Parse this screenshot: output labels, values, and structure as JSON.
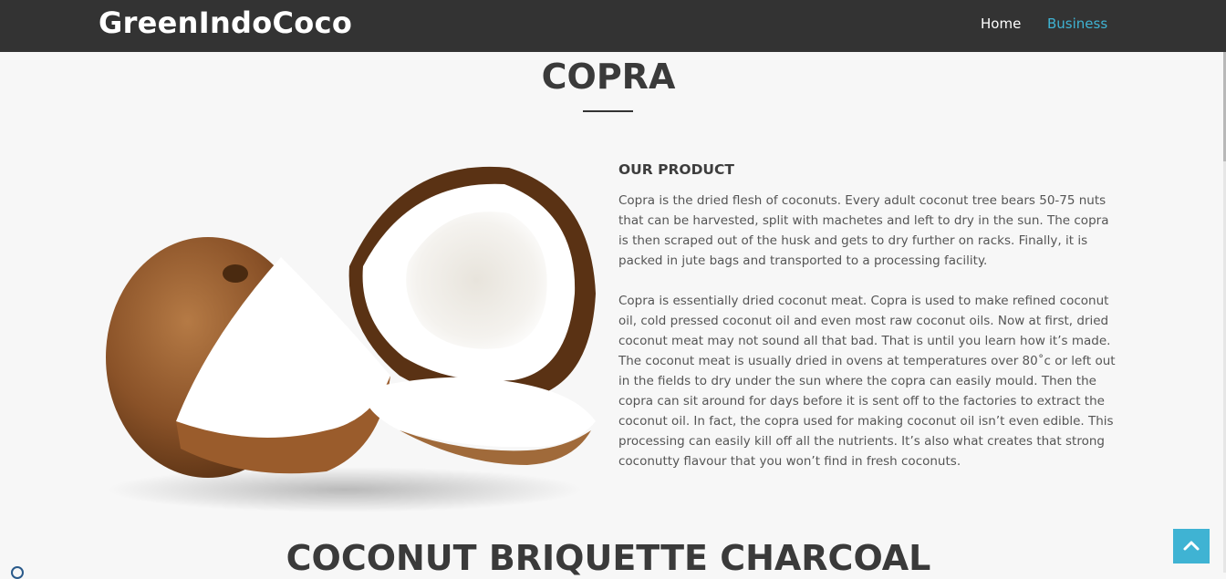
{
  "navbar": {
    "brand": "GreenIndoCoco",
    "links": [
      {
        "label": "Home"
      },
      {
        "label": "Business",
        "active": true
      }
    ],
    "active_color": "#3fb3d3"
  },
  "copra_section": {
    "title": "COPRA",
    "image": {
      "icon": "coconut-halves-photo"
    },
    "product_heading": "OUR PRODUCT",
    "paragraphs": [
      "Copra is the dried flesh of coconuts. Every adult coconut tree bears 50-75 nuts that can be harvested, split with machetes and left to dry in the sun. The copra is then scraped out of the husk and gets to dry further on racks. Finally, it is packed in jute bags and transported to a processing facility.",
      "Copra is essentially dried coconut meat. Copra is used to make refined coconut oil, cold pressed coconut oil and even most raw coconut oils. Now at first, dried coconut meat may not sound all that bad. That is until you learn how it’s made. The coconut meat is usually dried in ovens at temperatures over 80˚c or left out in the fields to dry under the sun where the copra can easily mould. Then the copra can sit around for days before it is sent off to the factories to extract the coconut oil. In fact, the copra used for making coconut oil isn’t even edible. This processing can easily kill off all the nutrients. It’s also what creates that strong coconutty flavour that you won’t find in fresh coconuts."
    ]
  },
  "briquette_section": {
    "title": "COCONUT BRIQUETTE CHARCOAL"
  },
  "back_to_top": {
    "icon": "chevron-up-icon",
    "color": "#3fb3d3"
  }
}
